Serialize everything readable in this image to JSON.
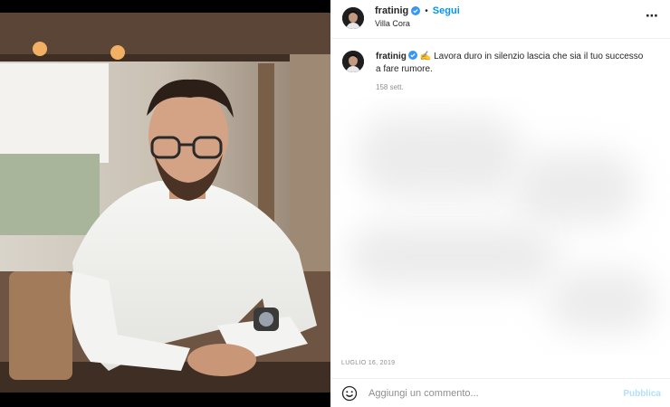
{
  "photo": {
    "alt_subject": "person-portrait"
  },
  "header": {
    "username": "fratinig",
    "separator": "•",
    "follow_label": "Segui",
    "location": "Villa Cora",
    "more_icon": "⋯"
  },
  "caption": {
    "username": "fratinig",
    "emoji": "✍️",
    "text": "Lavora duro in silenzio lascia che sia il tuo successo a fare rumore.",
    "time_ago": "158 sett."
  },
  "post_date": "LUGLIO 16, 2019",
  "comment": {
    "placeholder": "Aggiungi un commento...",
    "publish_label": "Pubblica"
  },
  "colors": {
    "accent": "#0095f6",
    "publish_disabled": "#b2dffc",
    "verified": "#3897f0",
    "muted": "#8e8e8e"
  }
}
